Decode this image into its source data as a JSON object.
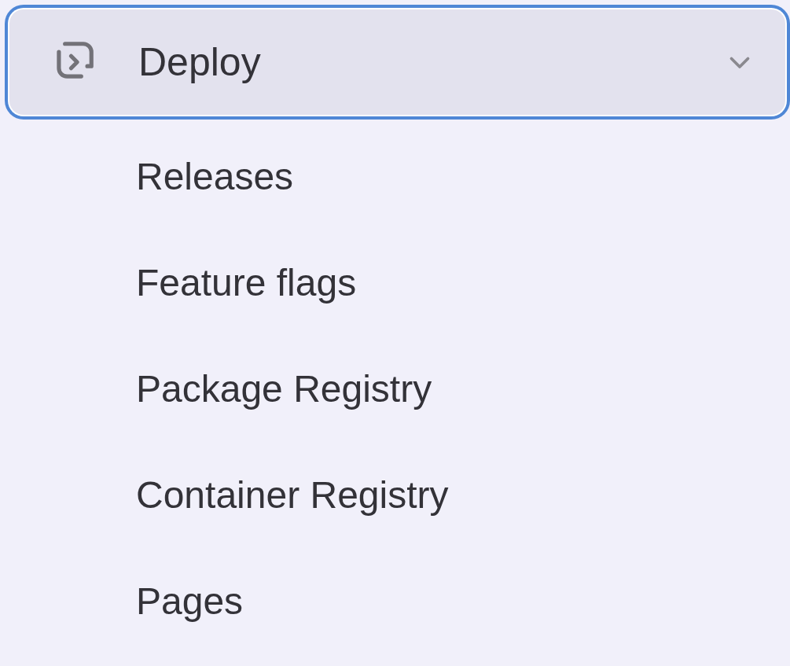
{
  "section": {
    "label": "Deploy",
    "expanded": true
  },
  "items": [
    {
      "label": "Releases"
    },
    {
      "label": "Feature flags"
    },
    {
      "label": "Package Registry"
    },
    {
      "label": "Container Registry"
    },
    {
      "label": "Pages"
    }
  ]
}
